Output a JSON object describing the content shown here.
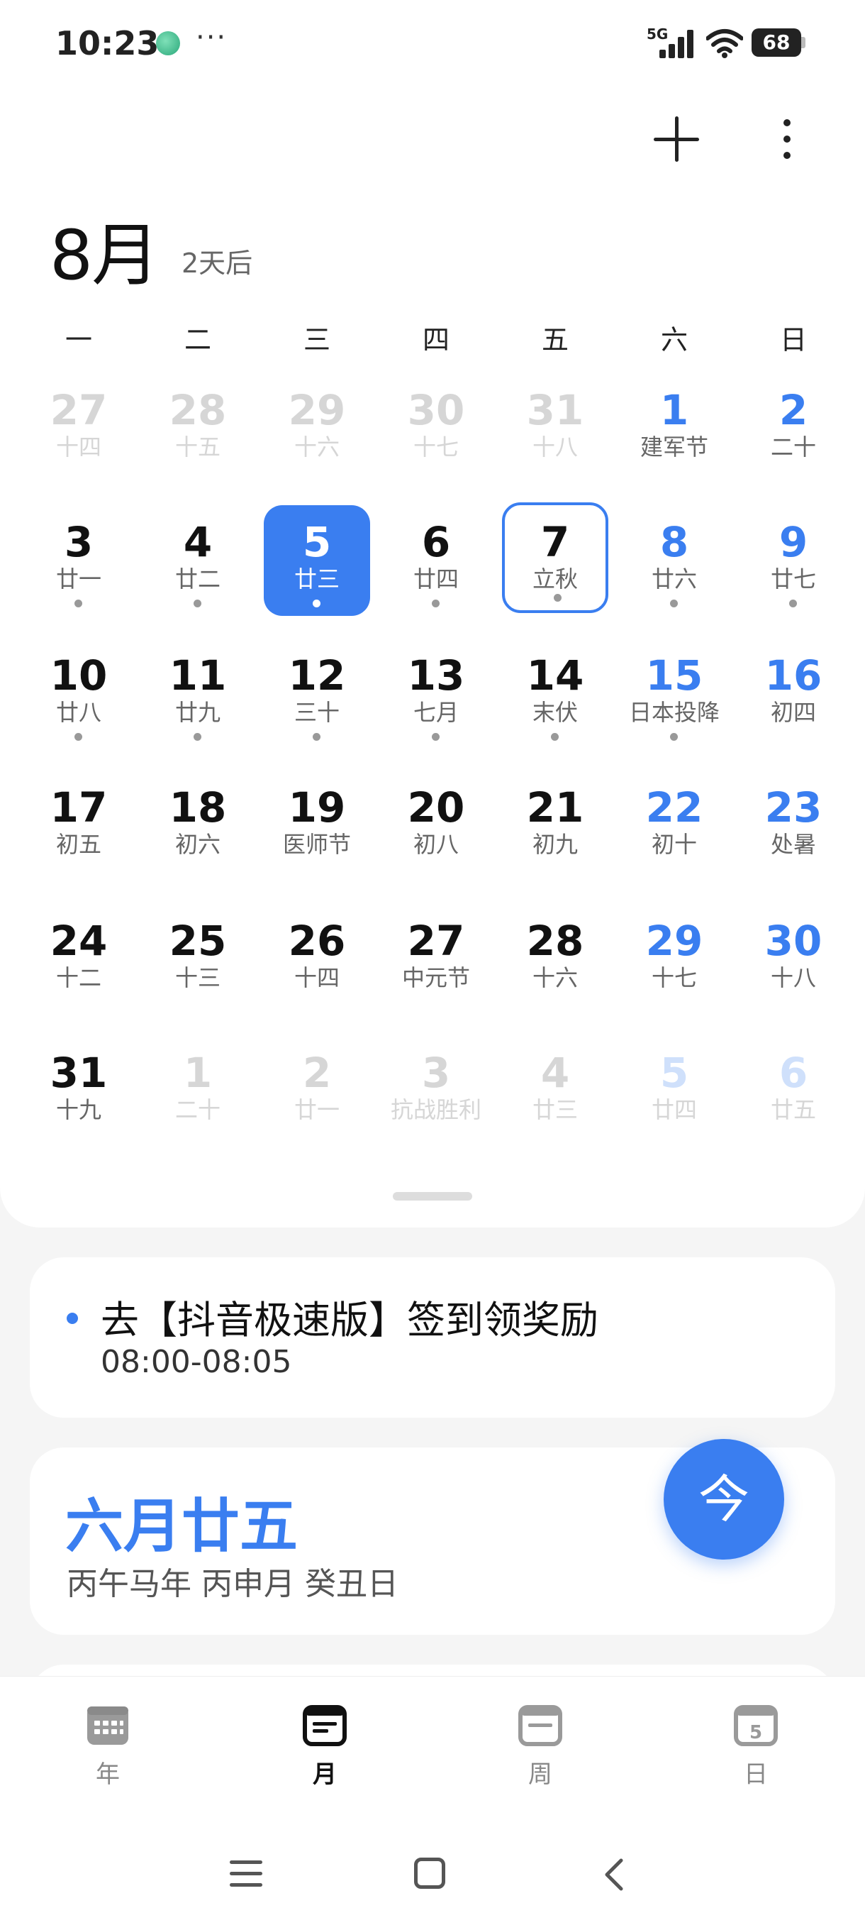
{
  "status_bar": {
    "time": "10:23",
    "more": "···",
    "network": "5G",
    "battery": "68"
  },
  "header": {
    "month": "8月",
    "subtitle": "2天后",
    "add_icon": "plus-icon",
    "more_icon": "more-vertical-icon"
  },
  "weekdays": [
    "一",
    "二",
    "三",
    "四",
    "五",
    "六",
    "日"
  ],
  "calendar": {
    "weeks": [
      [
        {
          "d": "27",
          "l": "十四",
          "faded": true
        },
        {
          "d": "28",
          "l": "十五",
          "faded": true
        },
        {
          "d": "29",
          "l": "十六",
          "faded": true
        },
        {
          "d": "30",
          "l": "十七",
          "faded": true
        },
        {
          "d": "31",
          "l": "十八",
          "faded": true
        },
        {
          "d": "1",
          "l": "建军节",
          "weekend": true
        },
        {
          "d": "2",
          "l": "二十",
          "weekend": true
        }
      ],
      [
        {
          "d": "3",
          "l": "廿一",
          "dot": true
        },
        {
          "d": "4",
          "l": "廿二",
          "dot": true
        },
        {
          "d": "5",
          "l": "廿三",
          "dot": true,
          "selected": true
        },
        {
          "d": "6",
          "l": "廿四",
          "dot": true
        },
        {
          "d": "7",
          "l": "立秋",
          "dot": true,
          "today": true
        },
        {
          "d": "8",
          "l": "廿六",
          "dot": true,
          "weekend": true
        },
        {
          "d": "9",
          "l": "廿七",
          "dot": true,
          "weekend": true
        }
      ],
      [
        {
          "d": "10",
          "l": "廿八",
          "dot": true
        },
        {
          "d": "11",
          "l": "廿九",
          "dot": true
        },
        {
          "d": "12",
          "l": "三十",
          "dot": true
        },
        {
          "d": "13",
          "l": "七月",
          "dot": true
        },
        {
          "d": "14",
          "l": "末伏",
          "dot": true
        },
        {
          "d": "15",
          "l": "日本投降",
          "dot": true,
          "weekend": true
        },
        {
          "d": "16",
          "l": "初四",
          "weekend": true
        }
      ],
      [
        {
          "d": "17",
          "l": "初五"
        },
        {
          "d": "18",
          "l": "初六"
        },
        {
          "d": "19",
          "l": "医师节"
        },
        {
          "d": "20",
          "l": "初八"
        },
        {
          "d": "21",
          "l": "初九"
        },
        {
          "d": "22",
          "l": "初十",
          "weekend": true
        },
        {
          "d": "23",
          "l": "处暑",
          "weekend": true
        }
      ],
      [
        {
          "d": "24",
          "l": "十二"
        },
        {
          "d": "25",
          "l": "十三"
        },
        {
          "d": "26",
          "l": "十四"
        },
        {
          "d": "27",
          "l": "中元节"
        },
        {
          "d": "28",
          "l": "十六"
        },
        {
          "d": "29",
          "l": "十七",
          "weekend": true
        },
        {
          "d": "30",
          "l": "十八",
          "weekend": true
        }
      ],
      [
        {
          "d": "31",
          "l": "十九"
        },
        {
          "d": "1",
          "l": "二十",
          "faded": true
        },
        {
          "d": "2",
          "l": "廿一",
          "faded": true
        },
        {
          "d": "3",
          "l": "抗战胜利",
          "faded": true
        },
        {
          "d": "4",
          "l": "廿三",
          "faded": true
        },
        {
          "d": "5",
          "l": "廿四",
          "faded": true,
          "weekend": true
        },
        {
          "d": "6",
          "l": "廿五",
          "faded": true,
          "weekend": true
        }
      ]
    ]
  },
  "event": {
    "title": "去【抖音极速版】签到领奖励",
    "time": "08:00-08:05"
  },
  "lunar": {
    "date": "六月廿五",
    "ganzhi": "丙午马年 丙申月 癸丑日"
  },
  "fab": {
    "label": "今"
  },
  "bottom_nav": {
    "items": [
      {
        "label": "年",
        "icon": "year-grid-icon"
      },
      {
        "label": "月",
        "icon": "month-icon",
        "active": true
      },
      {
        "label": "周",
        "icon": "week-icon"
      },
      {
        "label": "日",
        "icon": "day-icon",
        "badge": "5"
      }
    ]
  },
  "colors": {
    "accent": "#3a7ef0"
  }
}
